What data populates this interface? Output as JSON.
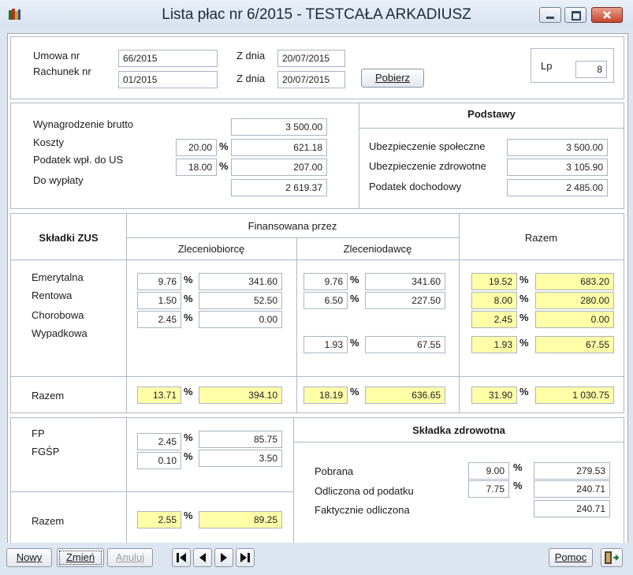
{
  "window": {
    "title": "Lista płac nr 6/2015 - TESTCAŁA ARKADIUSZ"
  },
  "contract": {
    "umowa_label": "Umowa nr",
    "umowa_value": "66/2015",
    "rachunek_label": "Rachunek nr",
    "rachunek_value": "01/2015",
    "zdnia_label": "Z dnia",
    "umowa_date": "20/07/2015",
    "rachunek_date": "20/07/2015",
    "pobierz_label": "Pobierz",
    "lp_label": "Lp",
    "lp_value": "8"
  },
  "summary": {
    "brutto_label": "Wynagrodzenie brutto",
    "brutto_value": "3 500.00",
    "koszty_label": "Koszty",
    "koszty_pct": "20.00",
    "koszty_value": "621.18",
    "podatek_label": "Podatek wpł. do US",
    "podatek_pct": "18.00",
    "podatek_value": "207.00",
    "wyplata_label": "Do wypłaty",
    "wyplata_value": "2 619.37",
    "pct_sign": "%"
  },
  "podstawy": {
    "title": "Podstawy",
    "spoleczne_label": "Ubezpieczenie społeczne",
    "spoleczne_value": "3 500.00",
    "zdrowotne_label": "Ubezpieczenie zdrowotne",
    "zdrowotne_value": "3 105.90",
    "dochodowy_label": "Podatek dochodowy",
    "dochodowy_value": "2 485.00"
  },
  "zus": {
    "title": "Składki ZUS",
    "financed_by": "Finansowana przez",
    "zleceniobiorca": "Zleceniobiorcę",
    "zleceniodawca": "Zleceniodawcę",
    "razem": "Razem",
    "rows": [
      {
        "label": "Emerytalna",
        "zb_pct": "9.76",
        "zb_val": "341.60",
        "zd_pct": "9.76",
        "zd_val": "341.60",
        "r_pct": "19.52",
        "r_val": "683.20"
      },
      {
        "label": "Rentowa",
        "zb_pct": "1.50",
        "zb_val": "52.50",
        "zd_pct": "6.50",
        "zd_val": "227.50",
        "r_pct": "8.00",
        "r_val": "280.00"
      },
      {
        "label": "Chorobowa",
        "zb_pct": "2.45",
        "zb_val": "0.00",
        "r_pct": "2.45",
        "r_val": "0.00"
      },
      {
        "label": "Wypadkowa",
        "zd_pct": "1.93",
        "zd_val": "67.55",
        "r_pct": "1.93",
        "r_val": "67.55"
      }
    ],
    "total": {
      "label": "Razem",
      "zb_pct": "13.71",
      "zb_val": "394.10",
      "zd_pct": "18.19",
      "zd_val": "636.65",
      "r_pct": "31.90",
      "r_val": "1 030.75"
    }
  },
  "funds": {
    "fp_label": "FP",
    "fp_pct": "2.45",
    "fp_val": "85.75",
    "fgsp_label": "FGŚP",
    "fgsp_pct": "0.10",
    "fgsp_val": "3.50",
    "razem_label": "Razem",
    "razem_pct": "2.55",
    "razem_val": "89.25"
  },
  "health": {
    "title": "Składka zdrowotna",
    "pobrana_label": "Pobrana",
    "pobrana_pct": "9.00",
    "pobrana_val": "279.53",
    "odliczona_label": "Odliczona od podatku",
    "odliczona_pct": "7.75",
    "odliczona_val": "240.71",
    "faktycznie_label": "Faktycznie odliczona",
    "faktycznie_val": "240.71"
  },
  "footer": {
    "nowy_label": "Nowy",
    "zmien_label": "Zmień",
    "anuluj_label": "Anuluj",
    "pomoc_label": "Pomoc"
  },
  "icons": {
    "first": "first-record-icon",
    "prev": "prev-record-icon",
    "next": "next-record-icon",
    "last": "last-record-icon",
    "exit": "exit-door-icon",
    "app": "app-books-icon"
  },
  "colors": {
    "highlight": "#ffffa8",
    "close_button": "#c74530"
  }
}
